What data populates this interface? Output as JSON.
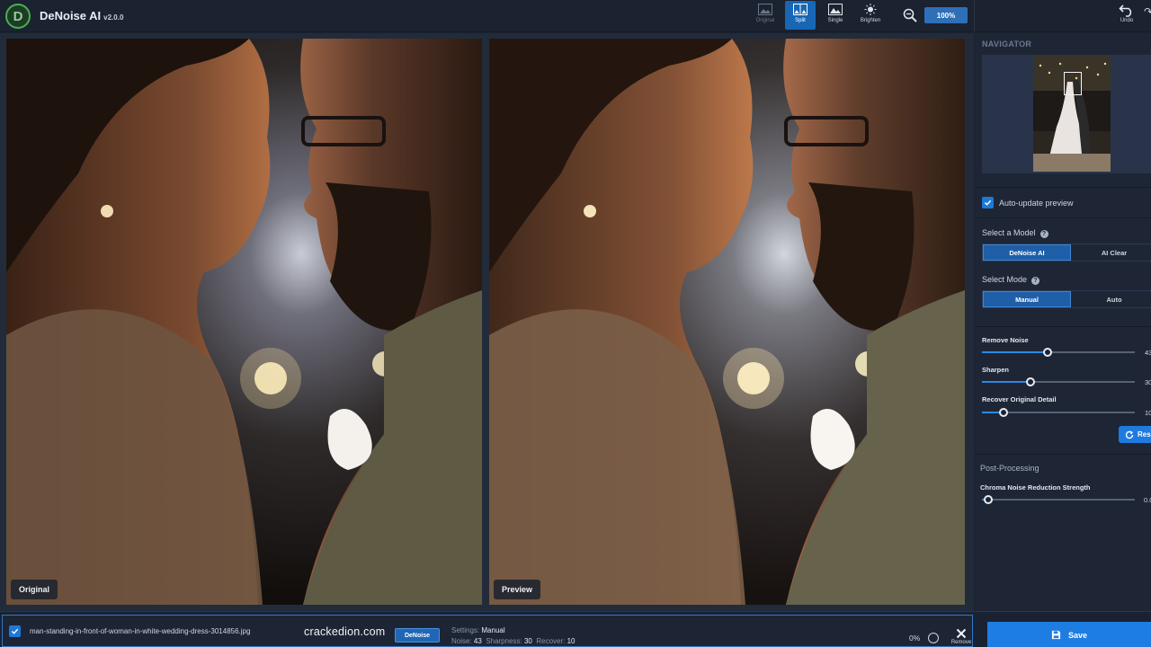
{
  "app": {
    "name": "DeNoise AI",
    "version": "v2.0.0"
  },
  "toolbar": {
    "views": [
      {
        "label": "Original",
        "icon": "image-icon"
      },
      {
        "label": "Split",
        "icon": "split-view-icon"
      },
      {
        "label": "Single",
        "icon": "single-view-icon"
      },
      {
        "label": "Brighten",
        "icon": "brighten-icon"
      }
    ],
    "active_view": "Split",
    "zoom": "100%",
    "undo_label": "Undo"
  },
  "canvas": {
    "left_label": "Original",
    "right_label": "Preview"
  },
  "panel": {
    "navigator_title": "NAVIGATOR",
    "auto_update_label": "Auto-update preview",
    "auto_update_checked": true,
    "select_model_label": "Select a Model",
    "models": [
      "DeNoise AI",
      "AI Clear"
    ],
    "selected_model": "DeNoise AI",
    "select_mode_label": "Select Mode",
    "modes": [
      "Manual",
      "Auto"
    ],
    "selected_mode": "Manual",
    "sliders": [
      {
        "label": "Remove Noise",
        "value": "43",
        "fraction": 0.43
      },
      {
        "label": "Sharpen",
        "value": "30",
        "fraction": 0.32
      },
      {
        "label": "Recover Original Detail",
        "value": "10",
        "fraction": 0.14
      }
    ],
    "reset_label": "Res",
    "post_processing_title": "Post-Processing",
    "chroma_label": "Chroma Noise Reduction Strength",
    "chroma_value": "0.0",
    "chroma_fraction": 0.04
  },
  "bottom": {
    "file_name": "man-standing-in-front-of-woman-in-white-wedding-dress-3014856.jpg",
    "watermark": "crackedion.com",
    "model_badge": "DeNoise",
    "settings_label": "Settings:",
    "settings_value": "Manual",
    "noise_label": "Noise:",
    "noise_value": "43",
    "sharpness_label": "Sharpness:",
    "sharpness_value": "30",
    "recover_label": "Recover:",
    "recover_value": "10",
    "progress": "0%",
    "remove_label": "Remove",
    "save_label": "Save"
  },
  "colors": {
    "accent": "#1e7de3",
    "panel_bg": "#1e2636",
    "topbar_bg": "#1b2230"
  }
}
